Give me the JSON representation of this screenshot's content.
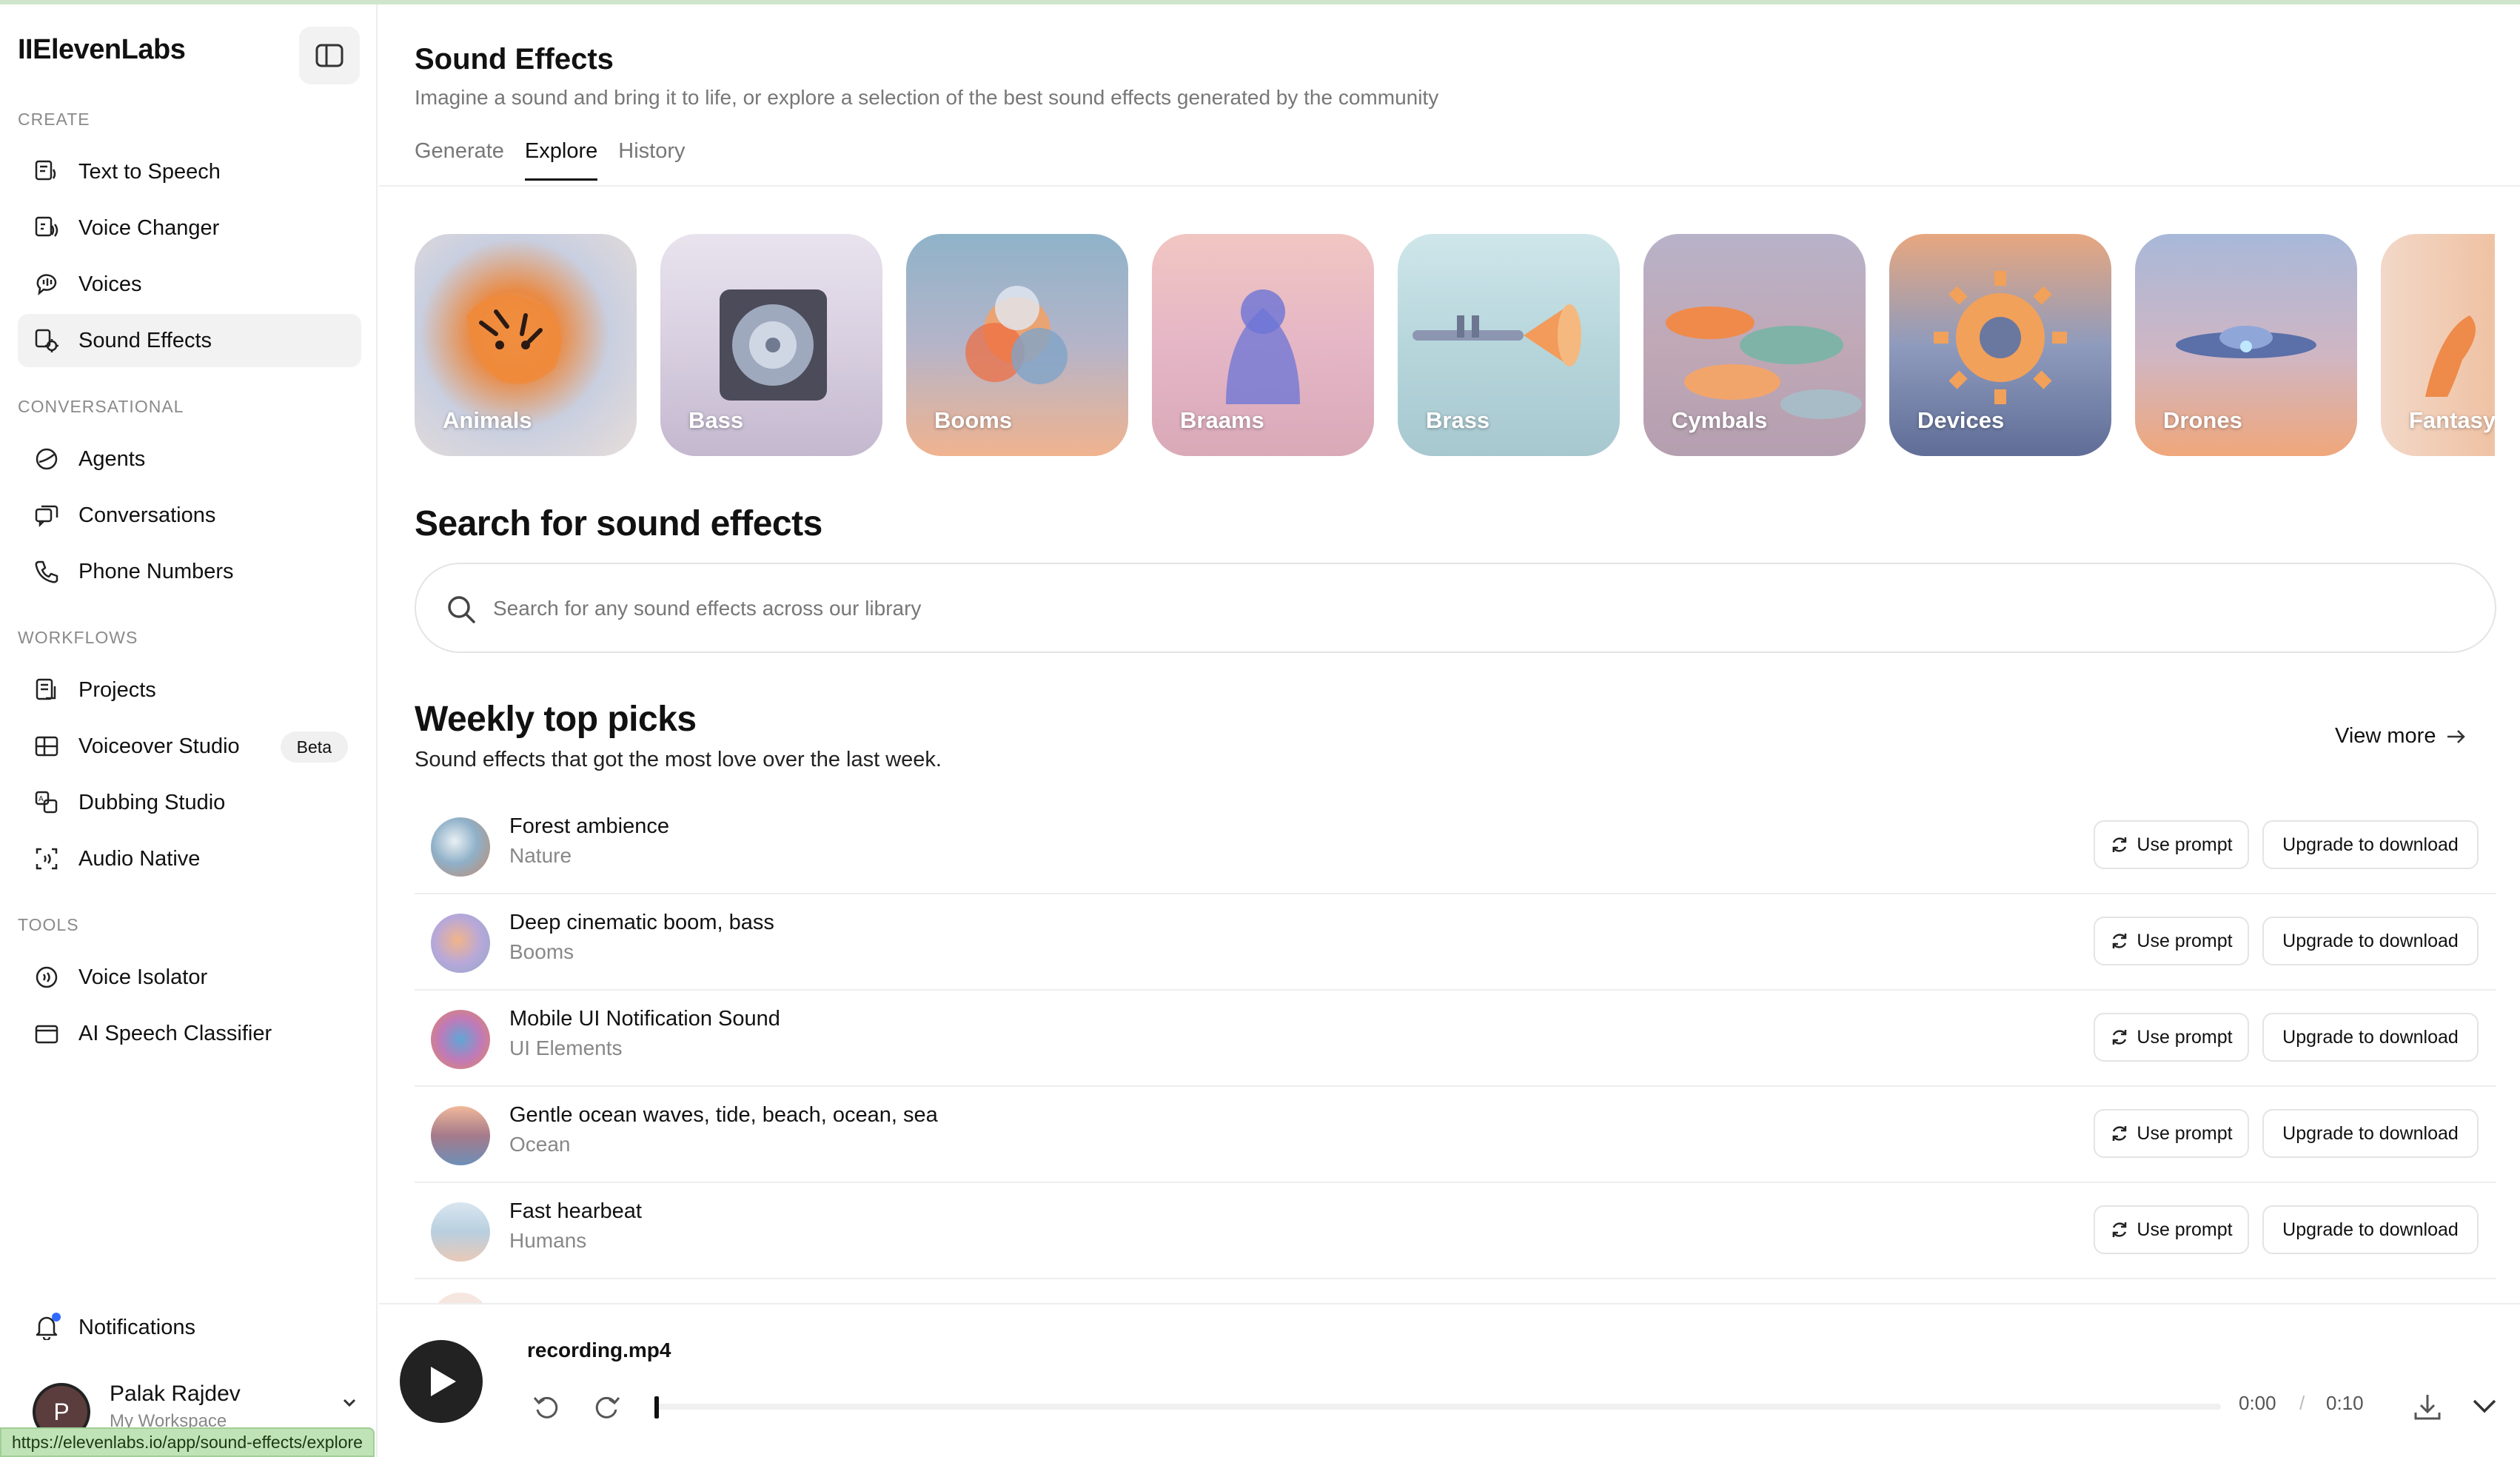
{
  "app": {
    "logo": "IIElevenLabs",
    "status_url": "https://elevenlabs.io/app/sound-effects/explore"
  },
  "sidebar": {
    "sections": {
      "create": "CREATE",
      "conversational": "CONVERSATIONAL",
      "workflows": "WORKFLOWS",
      "tools": "TOOLS"
    },
    "items": {
      "text_to_speech": "Text to Speech",
      "voice_changer": "Voice Changer",
      "voices": "Voices",
      "sound_effects": "Sound Effects",
      "agents": "Agents",
      "conversations": "Conversations",
      "phone_numbers": "Phone Numbers",
      "projects": "Projects",
      "voiceover_studio": "Voiceover Studio",
      "dubbing_studio": "Dubbing Studio",
      "audio_native": "Audio Native",
      "voice_isolator": "Voice Isolator",
      "ai_speech_classifier": "AI Speech Classifier"
    },
    "beta_badge": "Beta",
    "notifications": "Notifications",
    "user": {
      "initial": "P",
      "name": "Palak Rajdev",
      "workspace": "My Workspace"
    }
  },
  "header": {
    "title": "Sound Effects",
    "subtitle": "Imagine a sound and bring it to life, or explore a selection of the best sound effects generated by the community",
    "tabs": [
      "Generate",
      "Explore",
      "History"
    ],
    "active_tab": "Explore"
  },
  "categories": [
    "Animals",
    "Bass",
    "Booms",
    "Braams",
    "Brass",
    "Cymbals",
    "Devices",
    "Drones",
    "Fantasy"
  ],
  "search": {
    "heading": "Search for sound effects",
    "placeholder": "Search for any sound effects across our library"
  },
  "picks": {
    "title": "Weekly top picks",
    "subtitle": "Sound effects that got the most love over the last week.",
    "view_more": "View more",
    "use_prompt": "Use prompt",
    "upgrade": "Upgrade to download",
    "rows": [
      {
        "title": "Forest ambience",
        "category": "Nature"
      },
      {
        "title": "Deep cinematic boom, bass",
        "category": "Booms"
      },
      {
        "title": "Mobile UI Notification Sound",
        "category": "UI Elements"
      },
      {
        "title": "Gentle ocean waves, tide, beach, ocean, sea",
        "category": "Ocean"
      },
      {
        "title": "Fast hearbeat",
        "category": "Humans"
      }
    ]
  },
  "player": {
    "file_name": "recording.mp4",
    "current_time": "0:00",
    "separator": "/",
    "duration": "0:10",
    "progress": 0
  },
  "colors": {
    "accent_dark": "#222222",
    "active_bg": "#f2f2f2",
    "muted_text": "#888888",
    "notification_dot": "#2f6bff"
  }
}
